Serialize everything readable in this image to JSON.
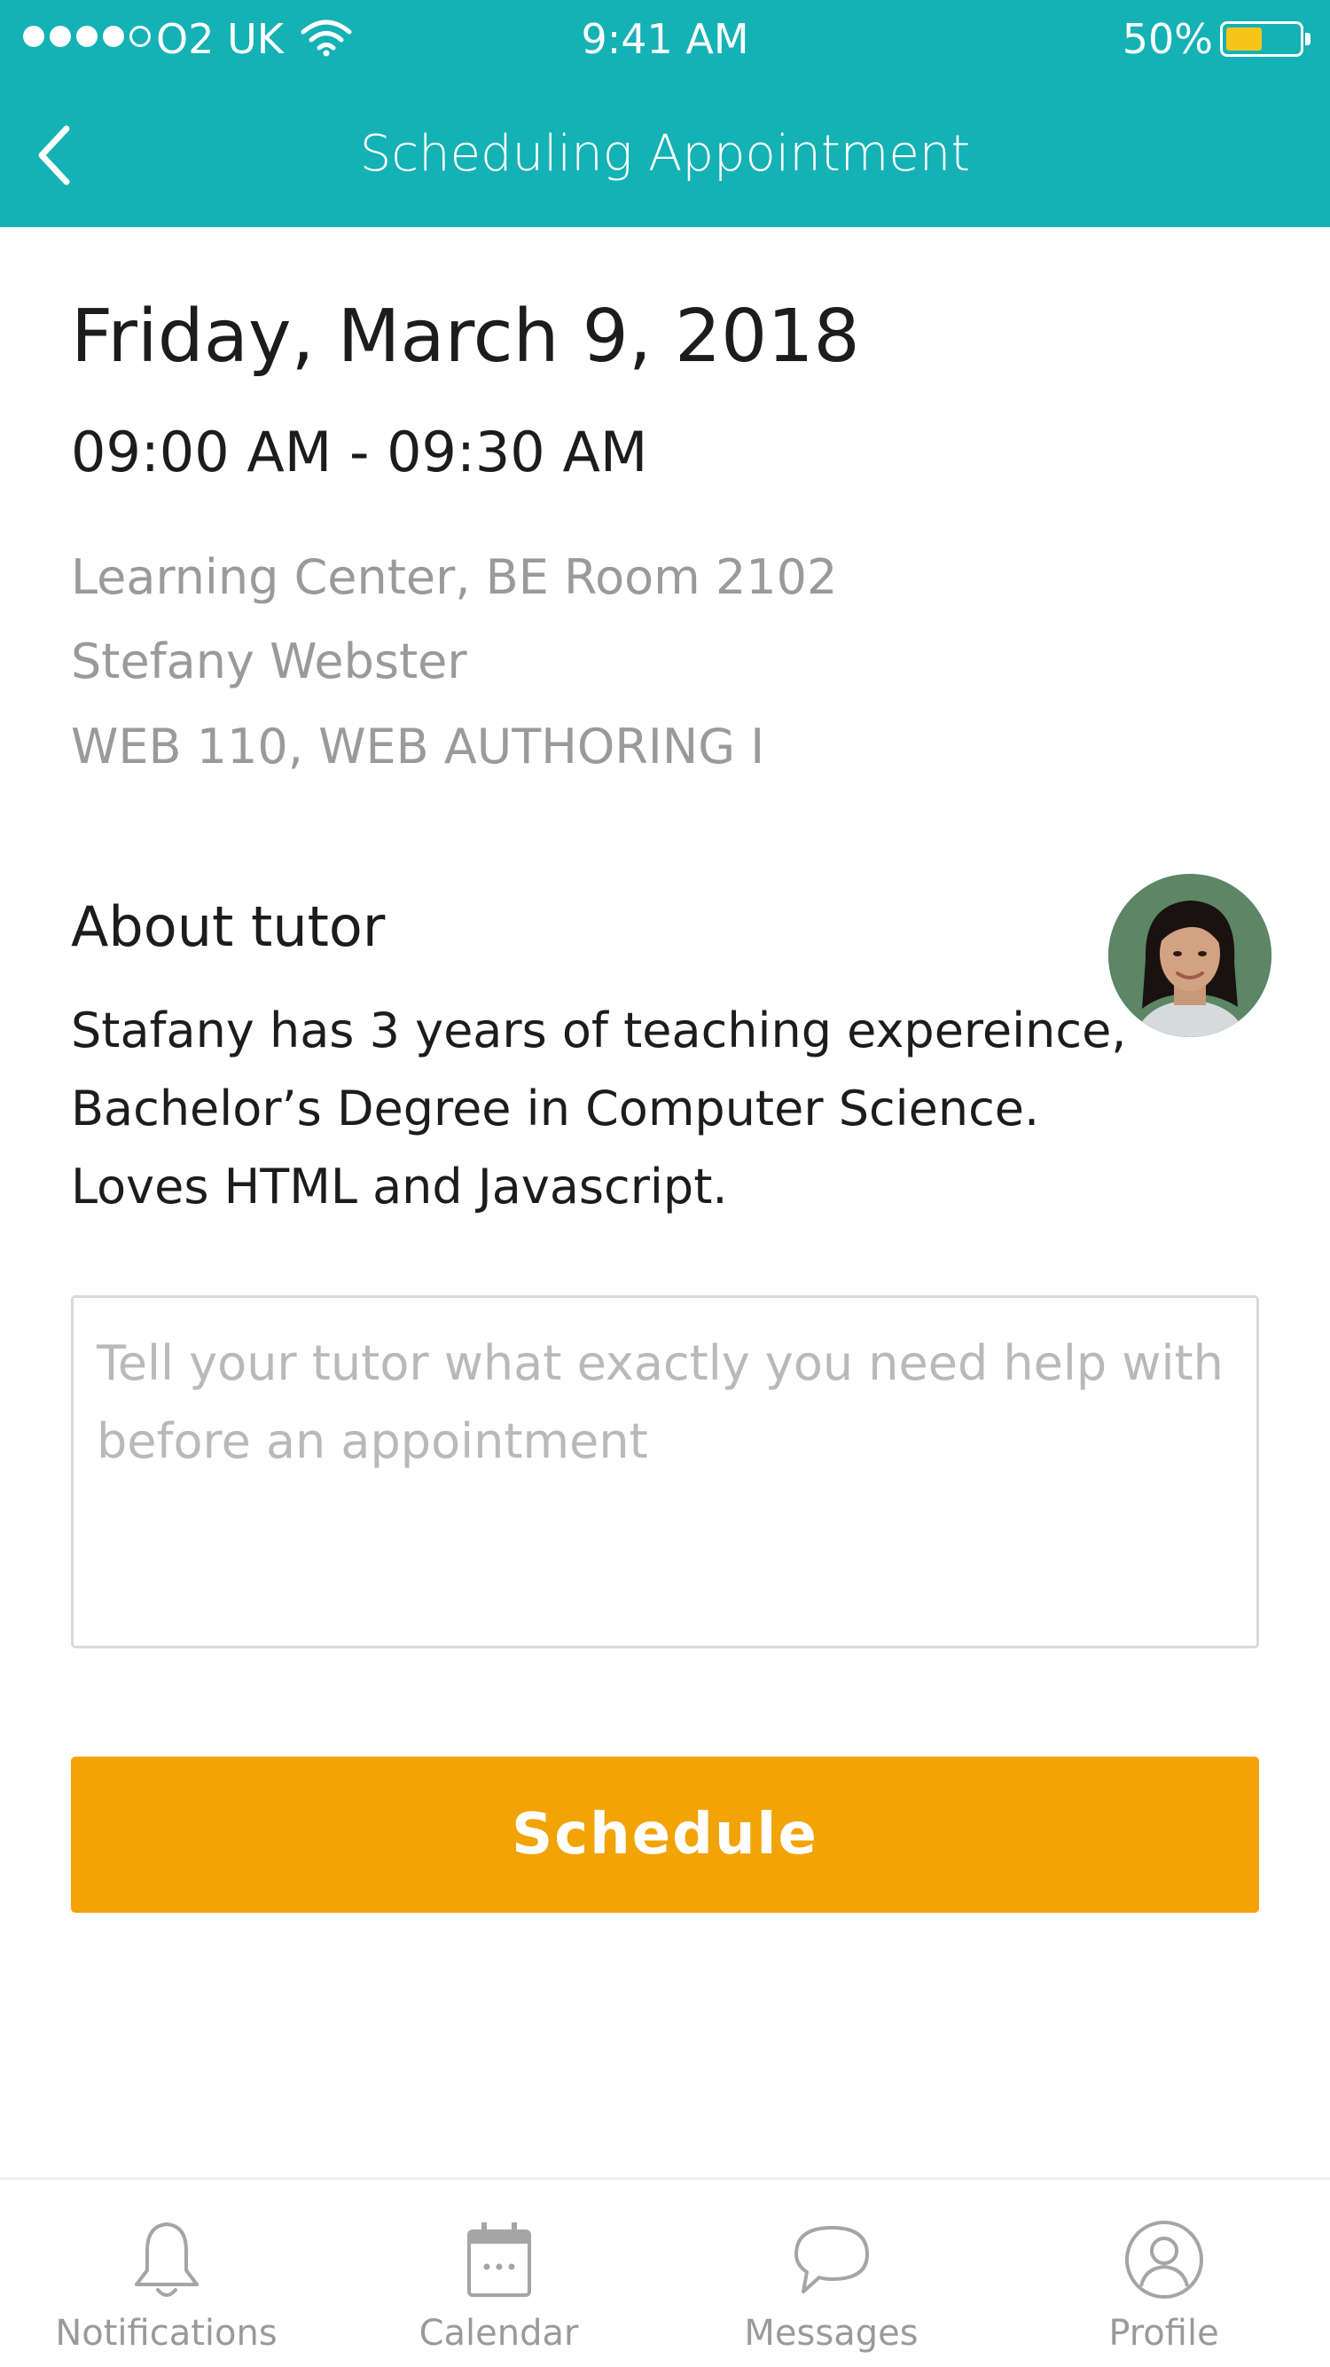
{
  "status_bar": {
    "carrier": "O2 UK",
    "time": "9:41 AM",
    "battery_percent": "50%",
    "battery_level": 0.5,
    "signal_bars_filled": 4,
    "signal_bars_total": 5
  },
  "nav": {
    "back_icon": "chevron-left-icon",
    "title": "Scheduling Appointment"
  },
  "appointment": {
    "date": "Friday, March 9, 2018",
    "time_range": "09:00 AM - 09:30 AM",
    "location": "Learning Center, BE Room 2102",
    "tutor_name": "Stefany Webster",
    "course": "WEB 110, WEB AUTHORING I"
  },
  "about": {
    "heading": "About tutor",
    "text": "Stafany has 3 years of teaching expereince, Bachelor’s Degree in Computer Science. Loves HTML and Javascript."
  },
  "message": {
    "placeholder": "Tell your tutor what exactly you need help with before an appointment",
    "value": ""
  },
  "schedule_button": {
    "label": "Schedule"
  },
  "tab_bar": {
    "items": [
      {
        "label": "Notifications",
        "icon": "bell-icon"
      },
      {
        "label": "Calendar",
        "icon": "calendar-icon"
      },
      {
        "label": "Messages",
        "icon": "chat-bubble-icon"
      },
      {
        "label": "Profile",
        "icon": "user-icon"
      }
    ]
  },
  "colors": {
    "header_bg": "#14b1b5",
    "schedule_button_bg": "#f2a305",
    "secondary_text": "#9a9a9a",
    "battery_fill": "#f5c518"
  }
}
